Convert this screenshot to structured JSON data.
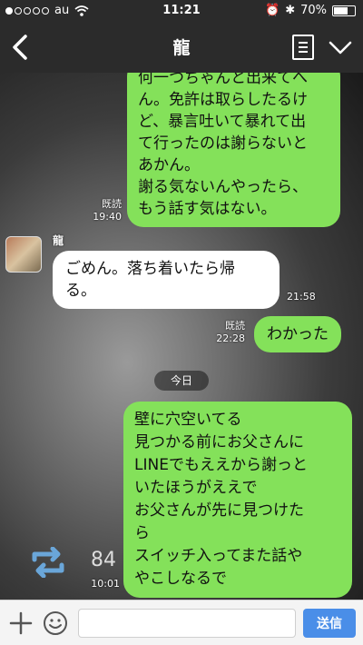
{
  "status": {
    "carrier": "au",
    "time": "11:21",
    "battery": "70%",
    "battery_level": 0.7
  },
  "nav": {
    "title": "龍"
  },
  "chat": {
    "messages": [
      {
        "text": "何一つちゃんと出来てへ\nん。免許は取らしたるけ\nど、暴言吐いて暴れて出\nて行ったのは謝らないと\nあかん。\n謝る気ないんやったら、\nもう話す気はない。",
        "read": "既読",
        "time": "19:40"
      },
      {
        "sender": "龍",
        "text": "ごめん。落ち着いたら帰\nる。",
        "time": "21:58"
      },
      {
        "text": "わかった",
        "read": "既読",
        "time": "22:28"
      },
      {
        "text": "壁に穴空いてる\n見つかる前にお父さんに\nLINEでもええから謝っと\nいたほうがええで\nお父さんが先に見つけた\nら\nスイッチ入ってまた話や\nやこしなるで",
        "time": "10:01"
      }
    ],
    "date_separator": "今日",
    "share_count": "84"
  },
  "input": {
    "placeholder": "",
    "send_label": "送信"
  },
  "colors": {
    "green_bubble": "#84e15a",
    "bar": "#2b2b2b",
    "send": "#4a8ee8"
  }
}
